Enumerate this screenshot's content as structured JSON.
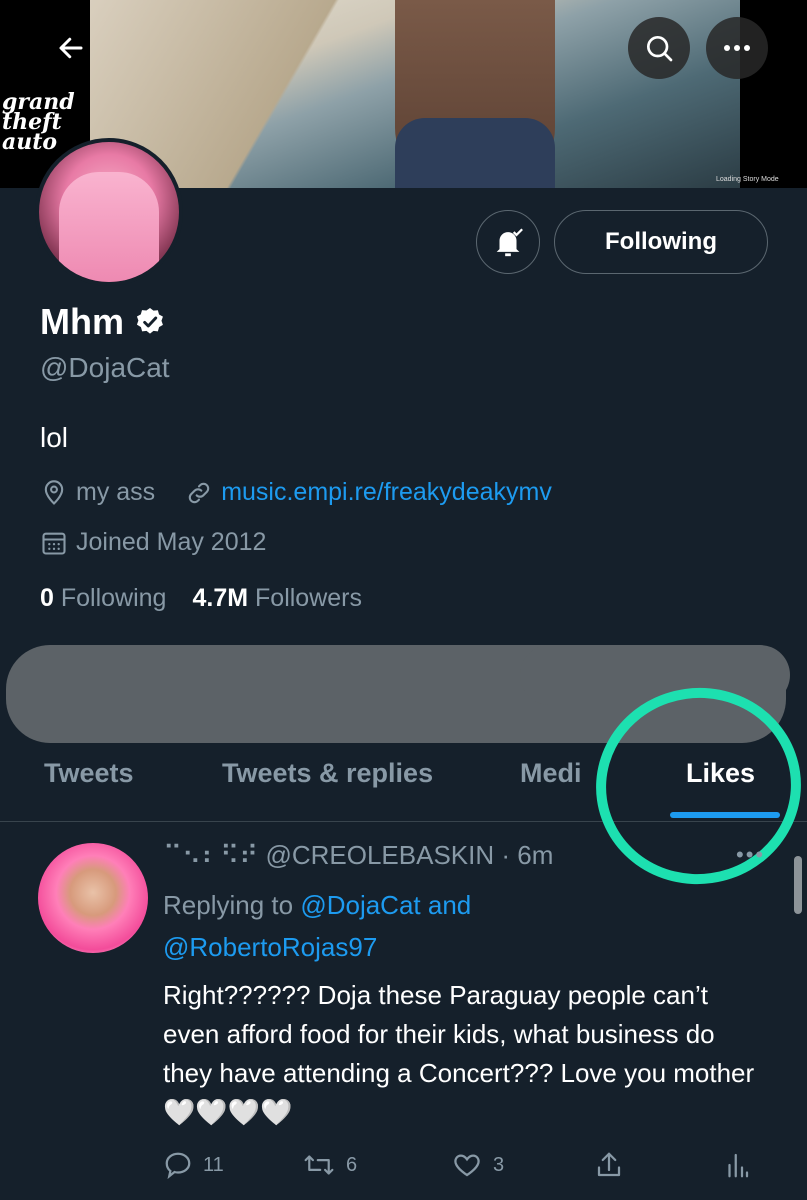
{
  "banner": {
    "overlay_logo": "grand theft auto",
    "loading_text": "Loading Story Mode"
  },
  "header": {
    "back_icon": "arrow-left-icon",
    "search_icon": "search-icon",
    "more_icon": "more-horizontal-icon"
  },
  "profile": {
    "display_name": "Mhm",
    "handle": "@DojaCat",
    "bio": "lol",
    "location": "my ass",
    "website": "music.empi.re/freakydeakymv",
    "joined": "Joined May 2012",
    "following_count": "0",
    "following_label": "Following",
    "followers_count": "4.7M",
    "followers_label": "Followers",
    "follow_button": "Following"
  },
  "tabs": [
    {
      "label": "Tweets"
    },
    {
      "label": "Tweets & replies"
    },
    {
      "label": "Medi"
    },
    {
      "label": "Likes"
    }
  ],
  "tweet": {
    "author_name": "⠉⠢⠆⠫⠞",
    "author_handle": "@CREOLEBASKIN",
    "time": "6m",
    "replying_prefix": "Replying to",
    "replying_to_1": "@DojaCat",
    "replying_and": "and",
    "replying_to_2": "@RobertoRojas97",
    "text": "Right?????? Doja these Paraguay people can’t even afford food for their kids, what business do they have attending a Concert??? Love you mother 🤍🤍🤍🤍",
    "replies": "11",
    "retweets": "6",
    "likes": "3"
  },
  "colors": {
    "background": "#15202b",
    "accent": "#1d9bf0",
    "muted": "#8899a6",
    "highlight": "#1de0b0"
  }
}
